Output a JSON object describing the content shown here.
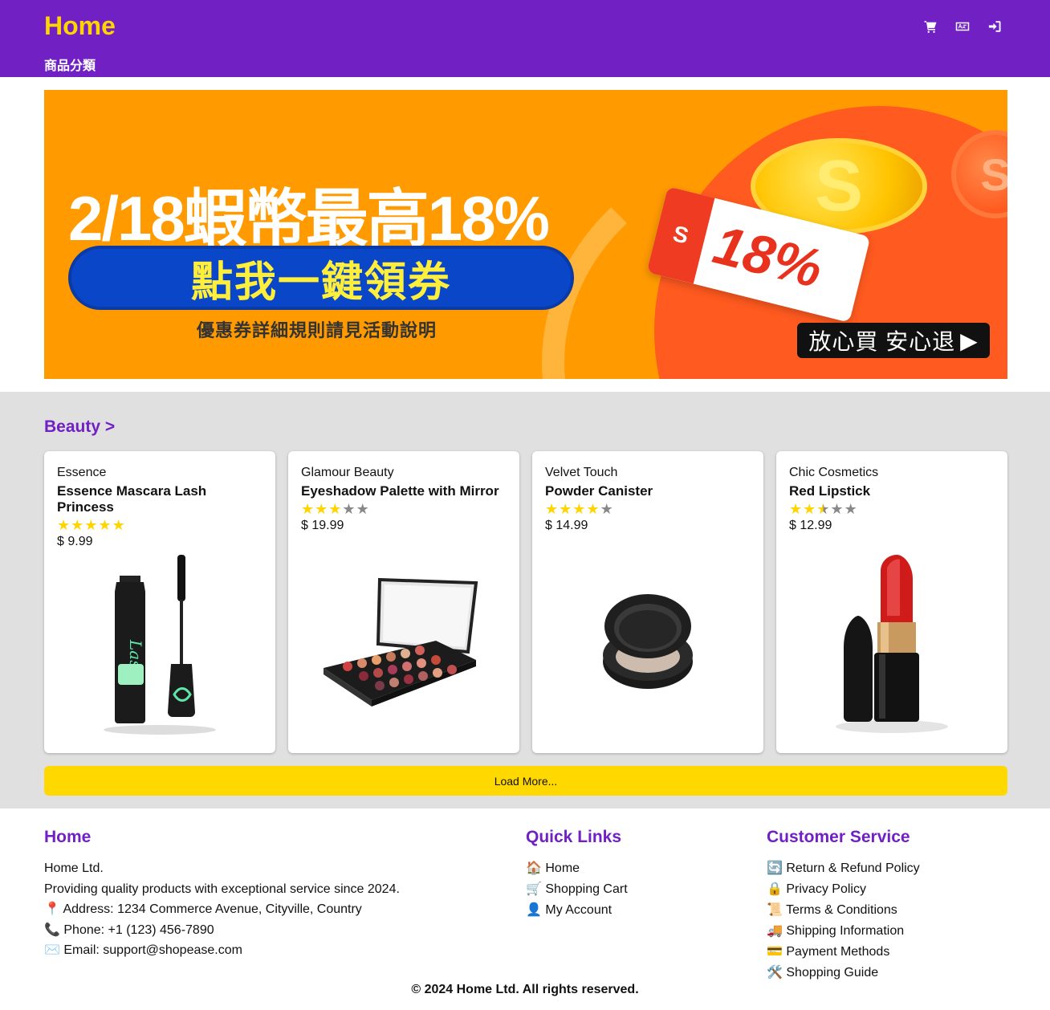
{
  "header": {
    "brand": "Home",
    "category_link": "商品分類",
    "icons": [
      "cart-icon",
      "language-icon",
      "login-icon"
    ]
  },
  "banner": {
    "headline": "2/18蝦幣最高18%",
    "cta": "點我一鍵領券",
    "subtext": "優惠券詳細規則請見活動說明",
    "ticket_percent": "18%",
    "ticket_tag": "S",
    "coin_letter": "S",
    "safe_label": "放心買 安心退"
  },
  "products": {
    "section_title": "Beauty >",
    "load_more": "Load More...",
    "items": [
      {
        "brand": "Essence",
        "name": "Essence Mascara Lash Princess",
        "rating": 5,
        "rating_max": 5,
        "price": "$ 9.99"
      },
      {
        "brand": "Glamour Beauty",
        "name": "Eyeshadow Palette with Mirror",
        "rating": 3,
        "rating_max": 5,
        "price": "$ 19.99"
      },
      {
        "brand": "Velvet Touch",
        "name": "Powder Canister",
        "rating": 4,
        "rating_max": 5,
        "price": "$ 14.99"
      },
      {
        "brand": "Chic Cosmetics",
        "name": "Red Lipstick",
        "rating": 2.5,
        "rating_max": 5,
        "price": "$ 12.99"
      }
    ]
  },
  "footer": {
    "about": {
      "title": "Home",
      "company": "Home Ltd.",
      "tagline": "Providing quality products with exceptional service since 2024.",
      "address": "📍 Address: 1234 Commerce Avenue, Cityville, Country",
      "phone": "📞 Phone: +1 (123) 456-7890",
      "email": "✉️ Email: support@shopease.com"
    },
    "quick_links": {
      "title": "Quick Links",
      "items": [
        "🏠 Home",
        "🛒 Shopping Cart",
        "👤 My Account"
      ]
    },
    "customer_service": {
      "title": "Customer Service",
      "items": [
        "🔄 Return & Refund Policy",
        "🔒 Privacy Policy",
        "📜 Terms & Conditions",
        "🚚 Shipping Information",
        "💳 Payment Methods",
        "🛠️ Shopping Guide"
      ]
    },
    "copyright": "© 2024 Home Ltd. All rights reserved."
  },
  "colors": {
    "header_bg": "#7120c4",
    "brand": "#ffd400",
    "banner_bg": "#ff9a00",
    "section_bg": "#e0e0e0",
    "load_more_bg": "#ffd800"
  }
}
